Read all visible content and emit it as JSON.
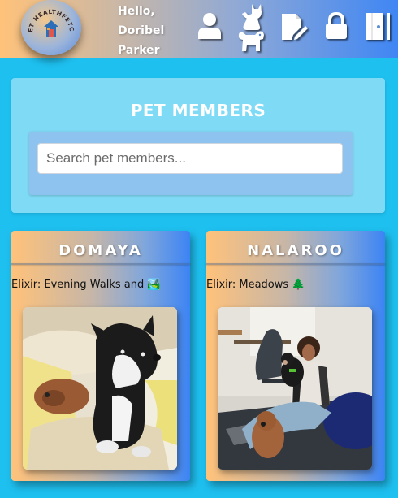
{
  "header": {
    "logo_text": "PET HEALTHFETCH",
    "greeting_line1": "Hello,",
    "greeting_line2": "Doribel",
    "greeting_line3": "Parker",
    "nav_icons": [
      "user-icon",
      "pets-icon",
      "edit-document-icon",
      "lock-icon",
      "logout-door-icon"
    ]
  },
  "search_panel": {
    "title": "PET MEMBERS",
    "placeholder": "Search pet members..."
  },
  "pets": [
    {
      "name": "DOMAYA",
      "elixir": "Elixir: Evening Walks and 🏞️"
    },
    {
      "name": "NALAROO",
      "elixir": "Elixir: Meadows 🌲"
    }
  ],
  "colors": {
    "page_bg": "#1ec0f0",
    "gradient_start": "#ffc27a",
    "gradient_end": "#3f86f4",
    "panel_bg": "#7fdaf5"
  }
}
